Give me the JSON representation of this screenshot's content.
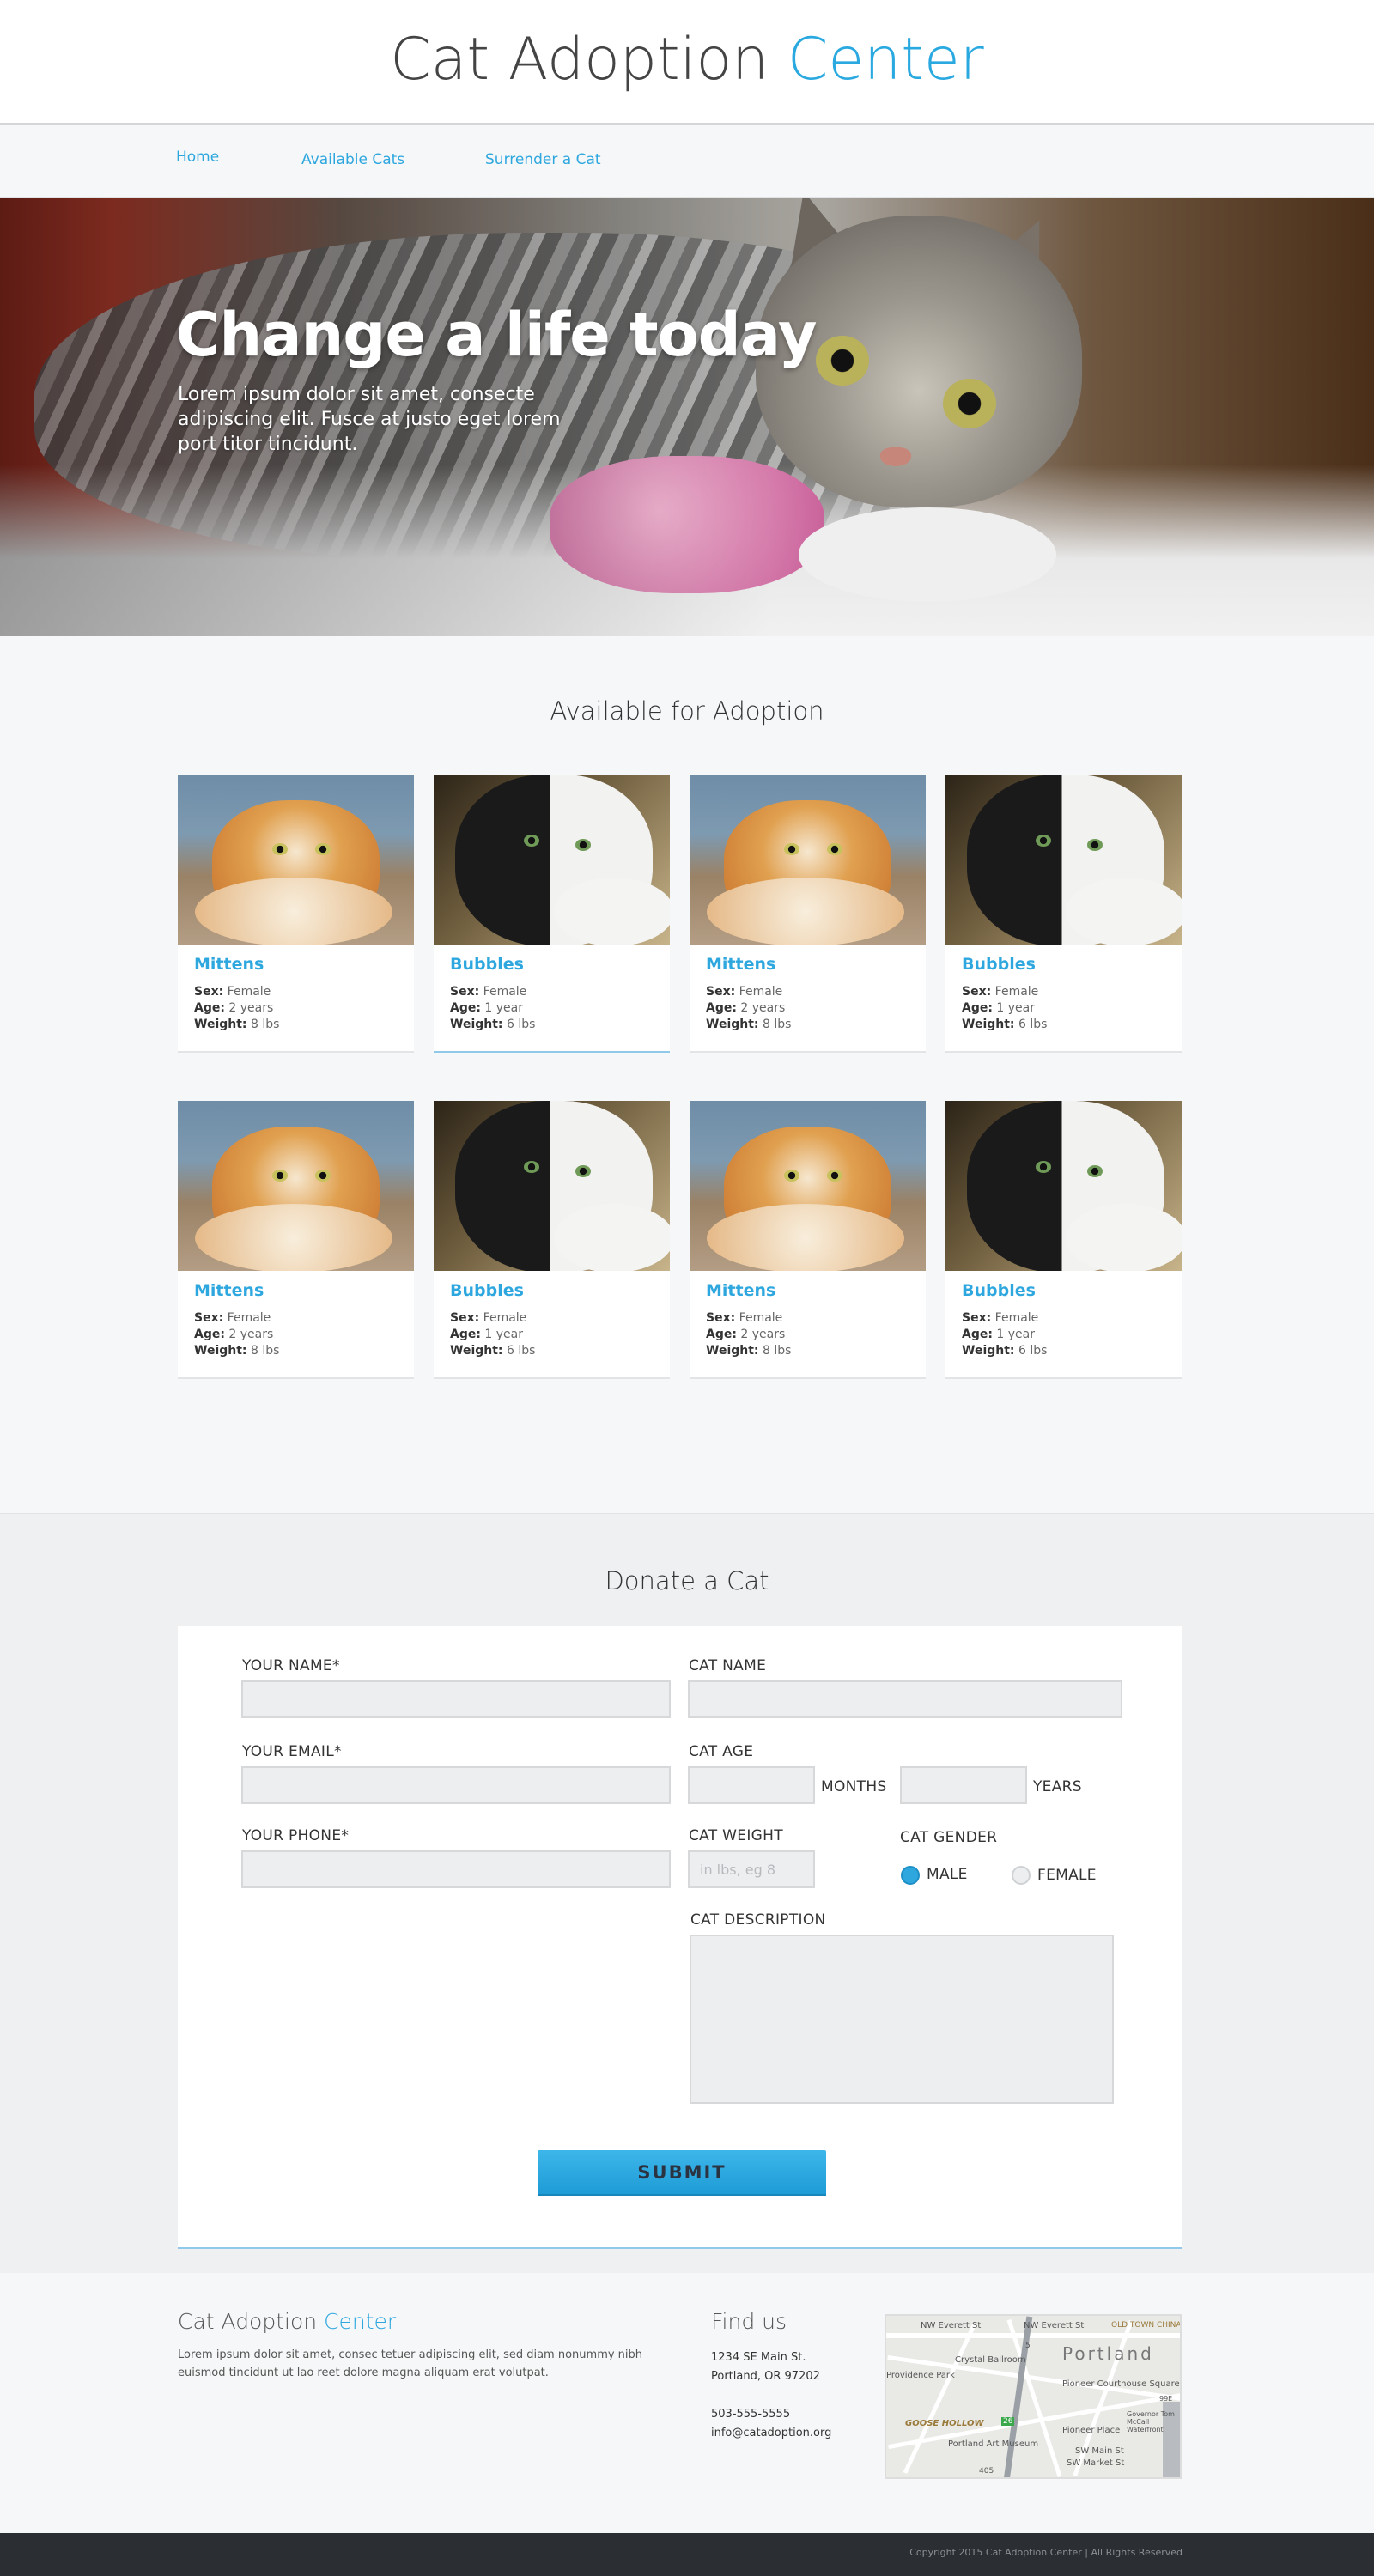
{
  "site": {
    "title_main": "Cat Adoption",
    "title_accent": "Center"
  },
  "nav": {
    "items": [
      {
        "label": "Home"
      },
      {
        "label": "Available Cats"
      },
      {
        "label": "Surrender a Cat"
      }
    ]
  },
  "hero": {
    "title": "Change a life today",
    "text": "Lorem ipsum dolor sit amet, consecte adipiscing elit. Fusce at justo eget lorem port titor tincidunt."
  },
  "available": {
    "title": "Available for Adoption",
    "labels": {
      "sex": "Sex:",
      "age": "Age:",
      "weight": "Weight:"
    },
    "cats": [
      {
        "name": "Mittens",
        "sex": "Female",
        "age": "2 years",
        "weight": "8 lbs",
        "photo": "orange-cat-photo"
      },
      {
        "name": "Bubbles",
        "sex": "Female",
        "age": "1 year",
        "weight": "6 lbs",
        "photo": "calico-cat-photo"
      },
      {
        "name": "Mittens",
        "sex": "Female",
        "age": "2 years",
        "weight": "8 lbs",
        "photo": "orange-cat-photo"
      },
      {
        "name": "Bubbles",
        "sex": "Female",
        "age": "1 year",
        "weight": "6 lbs",
        "photo": "calico-cat-photo"
      },
      {
        "name": "Mittens",
        "sex": "Female",
        "age": "2 years",
        "weight": "8 lbs",
        "photo": "orange-cat-photo"
      },
      {
        "name": "Bubbles",
        "sex": "Female",
        "age": "1 year",
        "weight": "6 lbs",
        "photo": "calico-cat-photo"
      },
      {
        "name": "Mittens",
        "sex": "Female",
        "age": "2 years",
        "weight": "8 lbs",
        "photo": "orange-cat-photo"
      },
      {
        "name": "Bubbles",
        "sex": "Female",
        "age": "1 year",
        "weight": "6 lbs",
        "photo": "calico-cat-photo"
      }
    ]
  },
  "donate": {
    "title": "Donate a Cat",
    "your_name_label": "YOUR NAME*",
    "your_email_label": "YOUR EMAIL*",
    "your_phone_label": "YOUR PHONE*",
    "cat_name_label": "CAT NAME",
    "cat_age_label": "CAT AGE",
    "months_label": "MONTHS",
    "years_label": "YEARS",
    "cat_weight_label": "CAT WEIGHT",
    "cat_weight_placeholder": "in lbs, eg 8",
    "cat_gender_label": "CAT GENDER",
    "gender_options": [
      "MALE",
      "FEMALE"
    ],
    "gender_selected": "MALE",
    "cat_description_label": "CAT DESCRIPTION",
    "submit_label": "SUBMIT"
  },
  "footer": {
    "title_main": "Cat Adoption",
    "title_accent": "Center",
    "text": "Lorem ipsum dolor sit amet, consec tetuer adipiscing elit, sed diam nonummy nibh euismod tincidunt ut lao reet dolore magna aliquam erat volutpat.",
    "find_title": "Find us",
    "address_line1": "1234 SE Main St.",
    "address_line2": "Portland, OR 97202",
    "phone": "503-555-5555",
    "email": "info@catadoption.org",
    "map": {
      "city": "Portland",
      "labels": [
        "NW Everett St",
        "NW Everett St",
        "OLD TOWN CHINATOWN",
        "Crystal Ballroom",
        "Providence Park",
        "Pioneer Courthouse Square",
        "Pioneer Place",
        "GOOSE HOLLOW",
        "Portland Art Museum",
        "SW Main St",
        "SW Market St",
        "Governor Tom McCall Waterfront",
        "405",
        "26",
        "5",
        "99E"
      ]
    },
    "copyright": "Copyright 2015 Cat Adoption Center | All Rights Reserved"
  },
  "colors": {
    "accent": "#2ea7df",
    "text": "#333333",
    "footer_bar": "#2b2e33"
  }
}
